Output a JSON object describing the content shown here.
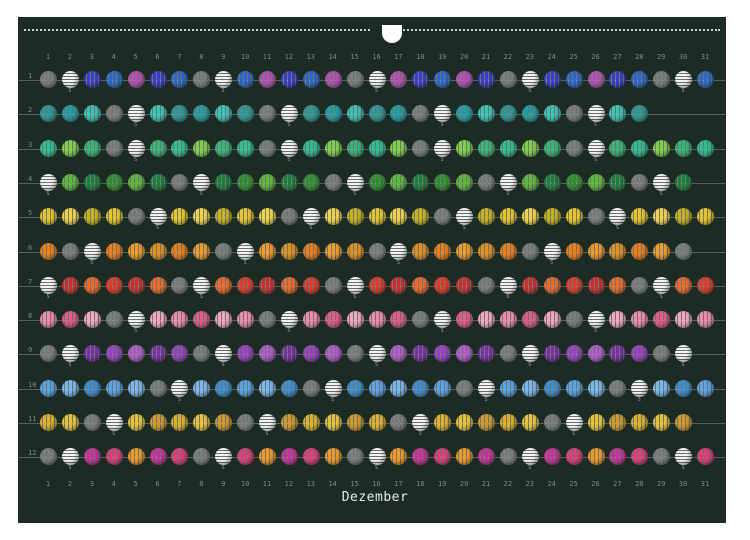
{
  "calendar": {
    "month_title": "Dezember",
    "day_numbers": [
      "1",
      "2",
      "3",
      "4",
      "5",
      "6",
      "7",
      "8",
      "9",
      "10",
      "11",
      "12",
      "13",
      "14",
      "15",
      "16",
      "17",
      "18",
      "19",
      "20",
      "21",
      "22",
      "23",
      "24",
      "25",
      "26",
      "27",
      "28",
      "29",
      "30",
      "31"
    ],
    "month_numbers": [
      "1",
      "2",
      "3",
      "4",
      "5",
      "6",
      "7",
      "8",
      "9",
      "10",
      "11",
      "12"
    ],
    "sunday_marker": "S",
    "colors": {
      "background": "#1c2b24",
      "white_bead": "#e8e8e8",
      "gray_bead": "#7d7f7c"
    },
    "months": [
      {
        "days": 31,
        "colors": [
          "#2b67c9",
          "#b84fb8",
          "#3a3ec9"
        ],
        "first_sunday_col": 2
      },
      {
        "days": 28,
        "colors": [
          "#2a9a9a",
          "#1fa0a8",
          "#3cc4b8"
        ],
        "first_sunday_col": 5
      },
      {
        "days": 31,
        "colors": [
          "#2fbf94",
          "#7fcf4a",
          "#38b778"
        ],
        "first_sunday_col": 5
      },
      {
        "days": 30,
        "colors": [
          "#2f8f2f",
          "#5fb93a",
          "#1e7f3d"
        ],
        "first_sunday_col": 1
      },
      {
        "days": 31,
        "colors": [
          "#e6c42a",
          "#f1d34a",
          "#c9b21f"
        ],
        "first_sunday_col": 6
      },
      {
        "days": 30,
        "colors": [
          "#ef7d18",
          "#f29a2a",
          "#e2901f"
        ],
        "first_sunday_col": 3
      },
      {
        "days": 31,
        "colors": [
          "#e23a2a",
          "#c92f2f",
          "#ef6a2a"
        ],
        "first_sunday_col": 1
      },
      {
        "days": 31,
        "colors": [
          "#f08ab0",
          "#e45a88",
          "#f4a6c2"
        ],
        "first_sunday_col": 5
      },
      {
        "days": 30,
        "colors": [
          "#9a3fc3",
          "#b65ad0",
          "#7a2fa3"
        ],
        "first_sunday_col": 2
      },
      {
        "days": 31,
        "colors": [
          "#5aa4e6",
          "#7ab6ef",
          "#3f8fd6"
        ],
        "first_sunday_col": 7
      },
      {
        "days": 30,
        "colors": [
          "#e0b02a",
          "#eac23a",
          "#d29a2a"
        ],
        "first_sunday_col": 4
      },
      {
        "days": 31,
        "colors": [
          "#e23a7a",
          "#f09a2a",
          "#c92f9a"
        ],
        "first_sunday_col": 2
      }
    ]
  }
}
